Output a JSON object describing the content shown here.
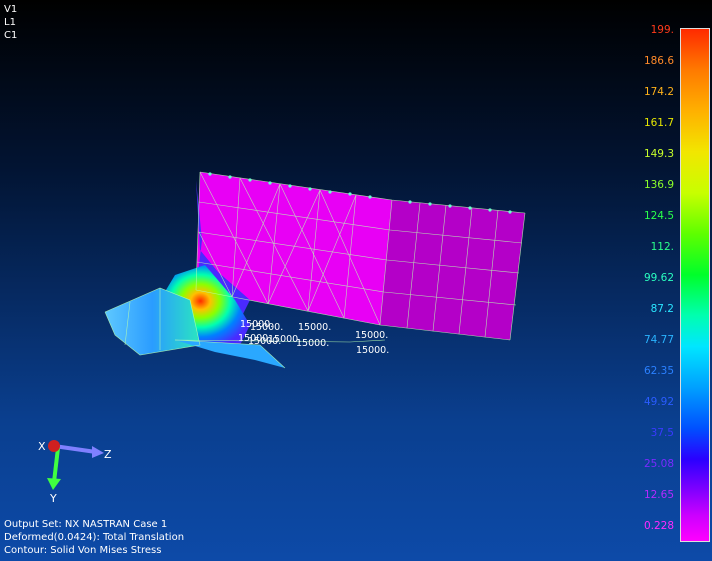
{
  "viewport_labels": [
    "V1",
    "L1",
    "C1"
  ],
  "legend": {
    "values": [
      "199.",
      "186.6",
      "174.2",
      "161.7",
      "149.3",
      "136.9",
      "124.5",
      "112.",
      "99.62",
      "87.2",
      "74.77",
      "62.35",
      "49.92",
      "37.5",
      "25.08",
      "12.65",
      "0.228"
    ],
    "colors": [
      "#ff3a1a",
      "#ff8a2a",
      "#ffb21a",
      "#e6e600",
      "#c8ff2a",
      "#8cff2a",
      "#2aff4a",
      "#2aff8a",
      "#2affc0",
      "#2ae6ff",
      "#2ab4ff",
      "#2a80ff",
      "#2a5cff",
      "#3a3aff",
      "#7a2aff",
      "#b42aff",
      "#ff2aff"
    ]
  },
  "load_labels": [
    "15000.",
    "15000.",
    "15000.",
    "15000.",
    "15000.",
    "15000.",
    "15000.",
    "15000.",
    "15000."
  ],
  "triad": {
    "x_label": "X",
    "y_label": "Y",
    "z_label": "Z"
  },
  "output_info": {
    "output_set": "Output Set: NX NASTRAN Case 1",
    "deformed": "Deformed(0.0424): Total Translation",
    "contour": "Contour: Solid Von Mises Stress"
  }
}
